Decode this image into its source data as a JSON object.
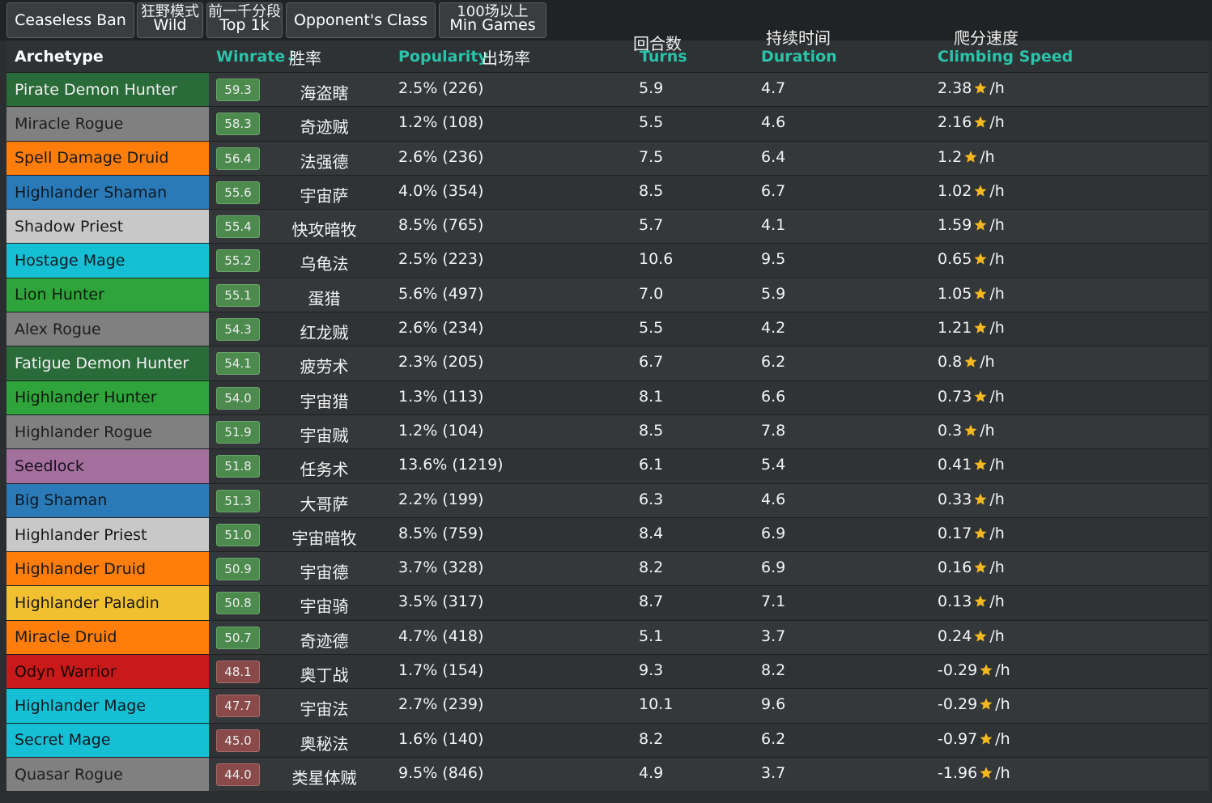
{
  "filters": [
    {
      "label": "Ceaseless Ban",
      "sub": ""
    },
    {
      "label": "Wild",
      "sub": "狂野模式"
    },
    {
      "label": "Top 1k",
      "sub": "前一千分段"
    },
    {
      "label": "Opponent's Class",
      "sub": ""
    },
    {
      "label": "Min Games",
      "sub": "100场以上"
    }
  ],
  "headers": {
    "archetype": "Archetype",
    "winrate": "Winrate↓",
    "winrate_cn": "胜率",
    "popularity": "Popularity",
    "popularity_cn": "出场率",
    "turns": "Turns",
    "turns_cn": "回合数",
    "duration": "Duration",
    "duration_cn": "持续时间",
    "climbing": "Climbing Speed",
    "climbing_cn": "爬分速度"
  },
  "unit": "/h",
  "colors": {
    "demonhunter": "#2a6b3a",
    "rogue": "#808080",
    "druid": "#ff7d0a",
    "shaman": "#2a7ab8",
    "priest": "#c8c8c8",
    "mage": "#16c0d4",
    "hunter": "#2ea43a",
    "warlock": "#a3709e",
    "paladin": "#f0c030",
    "warrior": "#c81a1a",
    "star": "#f5b820"
  },
  "rows": [
    {
      "archetype": "Pirate Demon Hunter",
      "class": "demonhunter",
      "winrate": "59.3",
      "cn": "海盗瞎",
      "popularity": "2.5% (226)",
      "turns": "5.9",
      "duration": "4.7",
      "climbing": "2.38"
    },
    {
      "archetype": "Miracle Rogue",
      "class": "rogue",
      "winrate": "58.3",
      "cn": "奇迹贼",
      "popularity": "1.2% (108)",
      "turns": "5.5",
      "duration": "4.6",
      "climbing": "2.16"
    },
    {
      "archetype": "Spell Damage Druid",
      "class": "druid",
      "winrate": "56.4",
      "cn": "法强德",
      "popularity": "2.6% (236)",
      "turns": "7.5",
      "duration": "6.4",
      "climbing": "1.2"
    },
    {
      "archetype": "Highlander Shaman",
      "class": "shaman",
      "winrate": "55.6",
      "cn": "宇宙萨",
      "popularity": "4.0% (354)",
      "turns": "8.5",
      "duration": "6.7",
      "climbing": "1.02"
    },
    {
      "archetype": "Shadow Priest",
      "class": "priest",
      "winrate": "55.4",
      "cn": "快攻暗牧",
      "popularity": "8.5% (765)",
      "turns": "5.7",
      "duration": "4.1",
      "climbing": "1.59"
    },
    {
      "archetype": "Hostage Mage",
      "class": "mage",
      "winrate": "55.2",
      "cn": "乌龟法",
      "popularity": "2.5% (223)",
      "turns": "10.6",
      "duration": "9.5",
      "climbing": "0.65"
    },
    {
      "archetype": "Lion Hunter",
      "class": "hunter",
      "winrate": "55.1",
      "cn": "蛋猎",
      "popularity": "5.6% (497)",
      "turns": "7.0",
      "duration": "5.9",
      "climbing": "1.05"
    },
    {
      "archetype": "Alex Rogue",
      "class": "rogue",
      "winrate": "54.3",
      "cn": "红龙贼",
      "popularity": "2.6% (234)",
      "turns": "5.5",
      "duration": "4.2",
      "climbing": "1.21"
    },
    {
      "archetype": "Fatigue Demon Hunter",
      "class": "demonhunter",
      "winrate": "54.1",
      "cn": "疲劳术",
      "popularity": "2.3% (205)",
      "turns": "6.7",
      "duration": "6.2",
      "climbing": "0.8"
    },
    {
      "archetype": "Highlander Hunter",
      "class": "hunter",
      "winrate": "54.0",
      "cn": "宇宙猎",
      "popularity": "1.3% (113)",
      "turns": "8.1",
      "duration": "6.6",
      "climbing": "0.73"
    },
    {
      "archetype": "Highlander Rogue",
      "class": "rogue",
      "winrate": "51.9",
      "cn": "宇宙贼",
      "popularity": "1.2% (104)",
      "turns": "8.5",
      "duration": "7.8",
      "climbing": "0.3"
    },
    {
      "archetype": "Seedlock",
      "class": "warlock",
      "winrate": "51.8",
      "cn": "任务术",
      "popularity": "13.6% (1219)",
      "turns": "6.1",
      "duration": "5.4",
      "climbing": "0.41"
    },
    {
      "archetype": "Big Shaman",
      "class": "shaman",
      "winrate": "51.3",
      "cn": "大哥萨",
      "popularity": "2.2% (199)",
      "turns": "6.3",
      "duration": "4.6",
      "climbing": "0.33"
    },
    {
      "archetype": "Highlander Priest",
      "class": "priest",
      "winrate": "51.0",
      "cn": "宇宙暗牧",
      "popularity": "8.5% (759)",
      "turns": "8.4",
      "duration": "6.9",
      "climbing": "0.17"
    },
    {
      "archetype": "Highlander Druid",
      "class": "druid",
      "winrate": "50.9",
      "cn": "宇宙德",
      "popularity": "3.7% (328)",
      "turns": "8.2",
      "duration": "6.9",
      "climbing": "0.16"
    },
    {
      "archetype": "Highlander Paladin",
      "class": "paladin",
      "winrate": "50.8",
      "cn": "宇宙骑",
      "popularity": "3.5% (317)",
      "turns": "8.7",
      "duration": "7.1",
      "climbing": "0.13"
    },
    {
      "archetype": "Miracle Druid",
      "class": "druid",
      "winrate": "50.7",
      "cn": "奇迹德",
      "popularity": "4.7% (418)",
      "turns": "5.1",
      "duration": "3.7",
      "climbing": "0.24"
    },
    {
      "archetype": "Odyn Warrior",
      "class": "warrior",
      "winrate": "48.1",
      "cn": "奥丁战",
      "popularity": "1.7% (154)",
      "turns": "9.3",
      "duration": "8.2",
      "climbing": "-0.29"
    },
    {
      "archetype": "Highlander Mage",
      "class": "mage",
      "winrate": "47.7",
      "cn": "宇宙法",
      "popularity": "2.7% (239)",
      "turns": "10.1",
      "duration": "9.6",
      "climbing": "-0.29"
    },
    {
      "archetype": "Secret Mage",
      "class": "mage",
      "winrate": "45.0",
      "cn": "奥秘法",
      "popularity": "1.6% (140)",
      "turns": "8.2",
      "duration": "6.2",
      "climbing": "-0.97"
    },
    {
      "archetype": "Quasar Rogue",
      "class": "rogue",
      "winrate": "44.0",
      "cn": "类星体贼",
      "popularity": "9.5% (846)",
      "turns": "4.9",
      "duration": "3.7",
      "climbing": "-1.96"
    }
  ]
}
